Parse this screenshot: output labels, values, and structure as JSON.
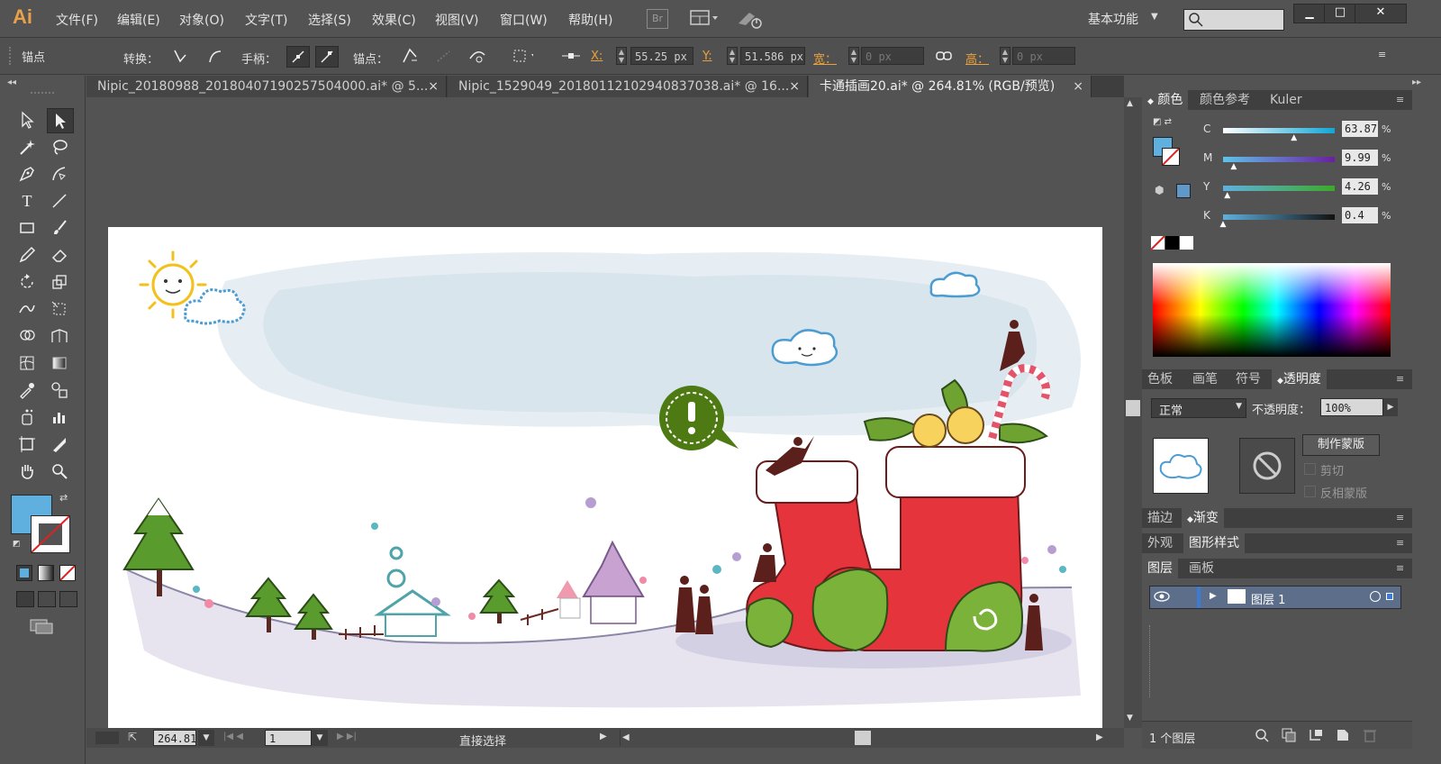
{
  "app": {
    "logo": "Ai"
  },
  "menu": [
    "文件(F)",
    "编辑(E)",
    "对象(O)",
    "文字(T)",
    "选择(S)",
    "效果(C)",
    "视图(V)",
    "窗口(W)",
    "帮助(H)"
  ],
  "menu_extras": {
    "br_label": "Br",
    "workspace": "基本功能",
    "window_min": "▁",
    "window_max": "□",
    "window_close": "✕"
  },
  "control": {
    "anchor_label": "锚点",
    "convert_label": "转换：",
    "handles_label": "手柄：",
    "anchor2_label": "锚点：",
    "x_label": "X:",
    "x_value": "55.25 px",
    "y_label": "Y:",
    "y_value": "51.586 px",
    "w_label": "宽：",
    "w_value": "0 px",
    "h_label": "高：",
    "h_value": "0 px"
  },
  "tabs": [
    {
      "label": "Nipic_20180988_20180407190257504000.ai* @ 5..."
    },
    {
      "label": "Nipic_1529049_20180112102940837038.ai* @ 16..."
    },
    {
      "label": "卡通插画20.ai* @ 264.81% (RGB/预览)"
    }
  ],
  "color_panel": {
    "tabs": [
      "颜色",
      "颜色参考",
      "Kuler"
    ],
    "channels": [
      {
        "name": "C",
        "value": "63.87"
      },
      {
        "name": "M",
        "value": "9.99"
      },
      {
        "name": "Y",
        "value": "4.26"
      },
      {
        "name": "K",
        "value": "0.4"
      }
    ],
    "channel_levels": [
      0.6387,
      0.0999,
      0.0426,
      0.004
    ],
    "percent": "%",
    "fill_color": "#5fb0de"
  },
  "transparency_panel": {
    "tabs": [
      "色板",
      "画笔",
      "符号",
      "透明度"
    ],
    "blend_mode": "正常",
    "opacity_label": "不透明度：",
    "opacity_value": "100%",
    "make_mask": "制作蒙版",
    "clip": "剪切",
    "invert": "反相蒙版"
  },
  "stroke_panel": {
    "tabs": [
      "描边",
      "渐变"
    ]
  },
  "appearance_panel": {
    "tabs": [
      "外观",
      "图形样式"
    ]
  },
  "layers_panel": {
    "tabs": [
      "图层",
      "画板"
    ],
    "layers": [
      {
        "name": "图层 1"
      }
    ],
    "count": "1 个图层"
  },
  "status": {
    "zoom": "264.81",
    "page": "1",
    "tool": "直接选择"
  }
}
